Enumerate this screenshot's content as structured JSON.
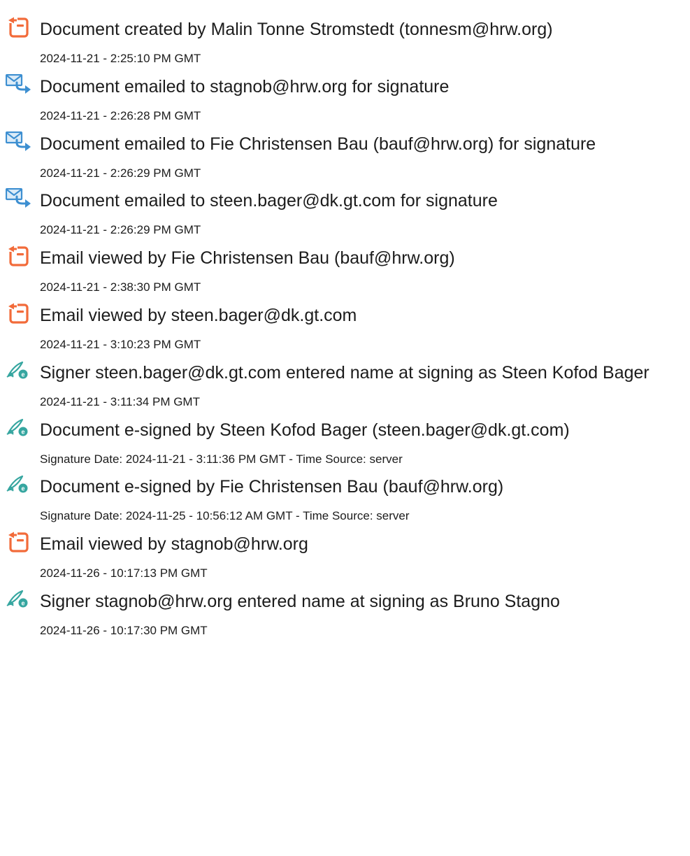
{
  "colors": {
    "document_icon": "#f26b3a",
    "email_icon": "#3d8fd1",
    "sign_icon": "#36a6a0",
    "text": "#1c1c1c"
  },
  "entries": [
    {
      "icon": "document-icon",
      "title": "Document created by Malin Tonne Stromstedt (tonnesm@hrw.org)",
      "detail": "2024-11-21 - 2:25:10 PM GMT"
    },
    {
      "icon": "email-send-icon",
      "title": "Document emailed to stagnob@hrw.org for signature",
      "detail": "2024-11-21 - 2:26:28 PM GMT"
    },
    {
      "icon": "email-send-icon",
      "title": "Document emailed to Fie Christensen Bau (bauf@hrw.org) for signature",
      "detail": "2024-11-21 - 2:26:29 PM GMT"
    },
    {
      "icon": "email-send-icon",
      "title": "Document emailed to steen.bager@dk.gt.com for signature",
      "detail": "2024-11-21 - 2:26:29 PM GMT"
    },
    {
      "icon": "document-icon",
      "title": "Email viewed by Fie Christensen Bau (bauf@hrw.org)",
      "detail": "2024-11-21 - 2:38:30 PM GMT"
    },
    {
      "icon": "document-icon",
      "title": "Email viewed by steen.bager@dk.gt.com",
      "detail": "2024-11-21 - 3:10:23 PM GMT"
    },
    {
      "icon": "pen-sign-icon",
      "title": "Signer steen.bager@dk.gt.com entered name at signing as Steen Kofod Bager",
      "detail": "2024-11-21 - 3:11:34 PM GMT"
    },
    {
      "icon": "pen-sign-icon",
      "title": "Document e-signed by Steen Kofod Bager (steen.bager@dk.gt.com)",
      "detail": "Signature Date: 2024-11-21 - 3:11:36 PM GMT - Time Source: server"
    },
    {
      "icon": "pen-sign-icon",
      "title": "Document e-signed by Fie Christensen Bau (bauf@hrw.org)",
      "detail": "Signature Date: 2024-11-25 - 10:56:12 AM GMT - Time Source: server"
    },
    {
      "icon": "document-icon",
      "title": "Email viewed by stagnob@hrw.org",
      "detail": "2024-11-26 - 10:17:13 PM GMT"
    },
    {
      "icon": "pen-sign-icon",
      "title": "Signer stagnob@hrw.org entered name at signing as Bruno Stagno",
      "detail": "2024-11-26 - 10:17:30 PM GMT"
    }
  ]
}
